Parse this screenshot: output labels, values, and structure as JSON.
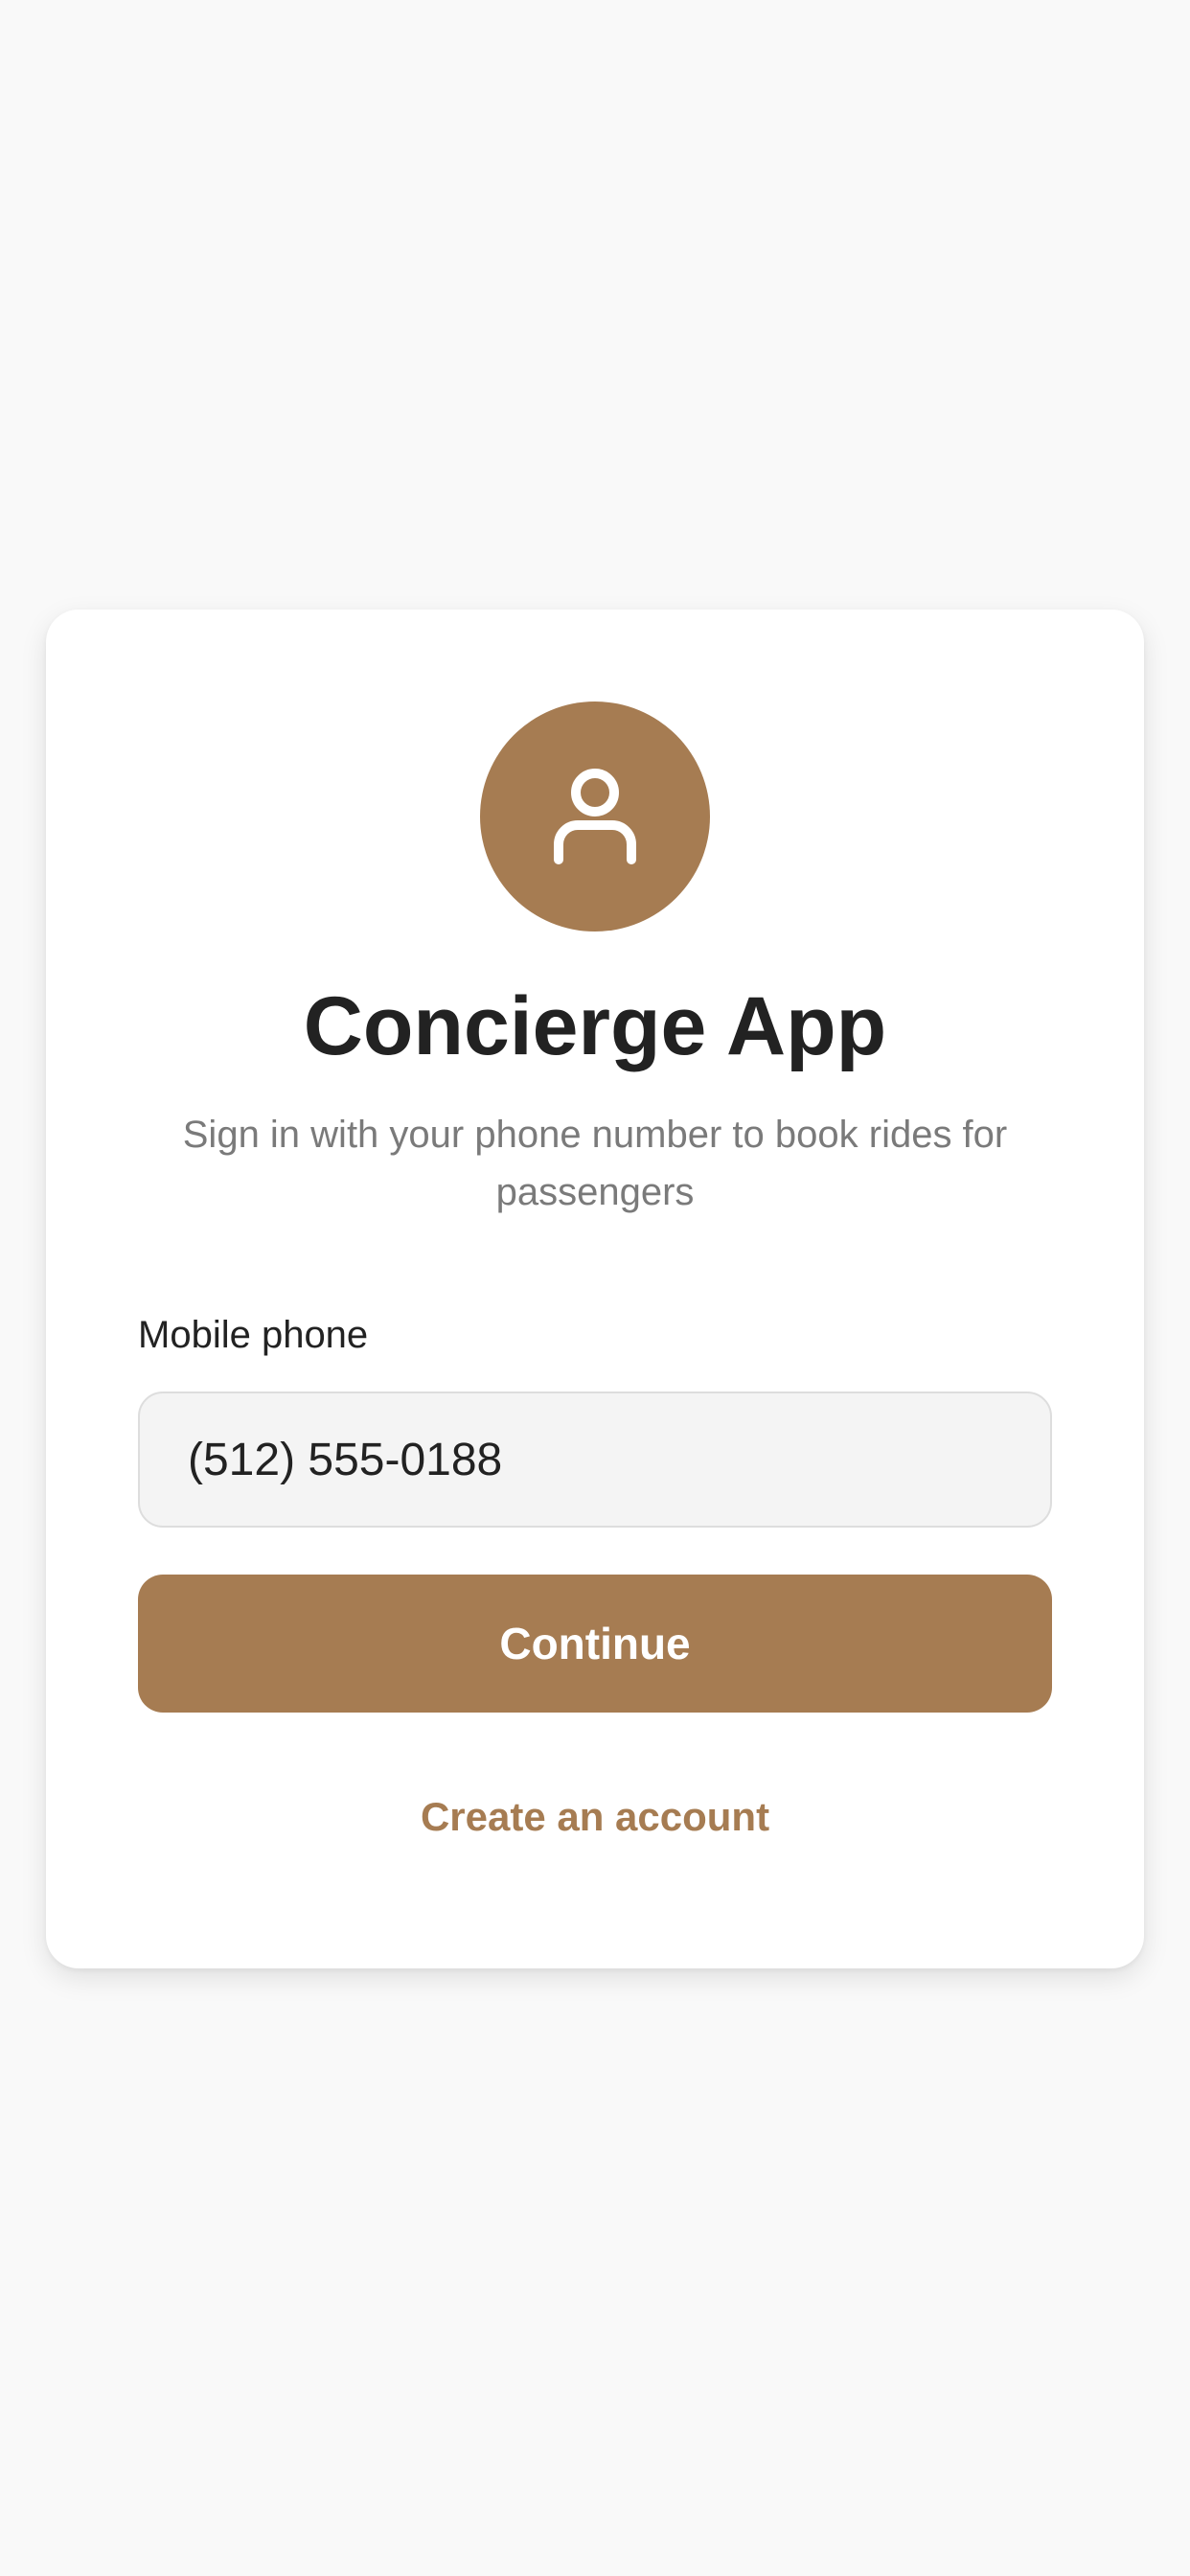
{
  "colors": {
    "background": "#f9f9f9",
    "card": "#ffffff",
    "accent": "#a67c52",
    "title_text": "#222222",
    "subtitle_text": "#7a7a7a"
  },
  "header": {
    "icon": "user-icon",
    "title": "Concierge App",
    "subtitle": "Sign in with your phone number to book rides for passengers"
  },
  "form": {
    "phone_label": "Mobile phone",
    "phone_value": "(512) 555-0188",
    "continue_label": "Continue"
  },
  "footer": {
    "create_account_label": "Create an account"
  }
}
